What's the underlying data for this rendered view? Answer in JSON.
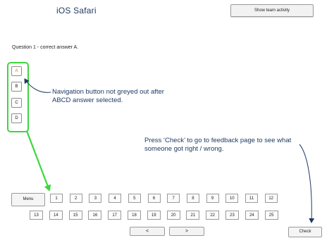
{
  "header": {
    "title": "iOS Safari",
    "show_team_label": "Show team activity"
  },
  "question": {
    "text": "Question 1 - correct answer A."
  },
  "options": [
    "A",
    "B",
    "C",
    "D"
  ],
  "annotations": {
    "nav_note_line1": "Navigation button not greyed out after",
    "nav_note_line2": "ABCD answer selected.",
    "check_note_line1": "Press ‘Check’ to go to feedback page to see what",
    "check_note_line2": "someone got right / wrong."
  },
  "navigation": {
    "menu_label": "Menu",
    "row1": [
      "1",
      "2",
      "3",
      "4",
      "5",
      "6",
      "7",
      "8",
      "9",
      "10",
      "11",
      "12"
    ],
    "row2": [
      "13",
      "14",
      "15",
      "16",
      "17",
      "18",
      "19",
      "20",
      "21",
      "22",
      "23",
      "24",
      "25"
    ],
    "prev_label": "<",
    "next_label": ">",
    "check_label": "Check"
  },
  "colors": {
    "highlight_green": "#3ed63e",
    "annotation_blue": "#1f3a63",
    "selected_orange": "#e07a1a"
  }
}
